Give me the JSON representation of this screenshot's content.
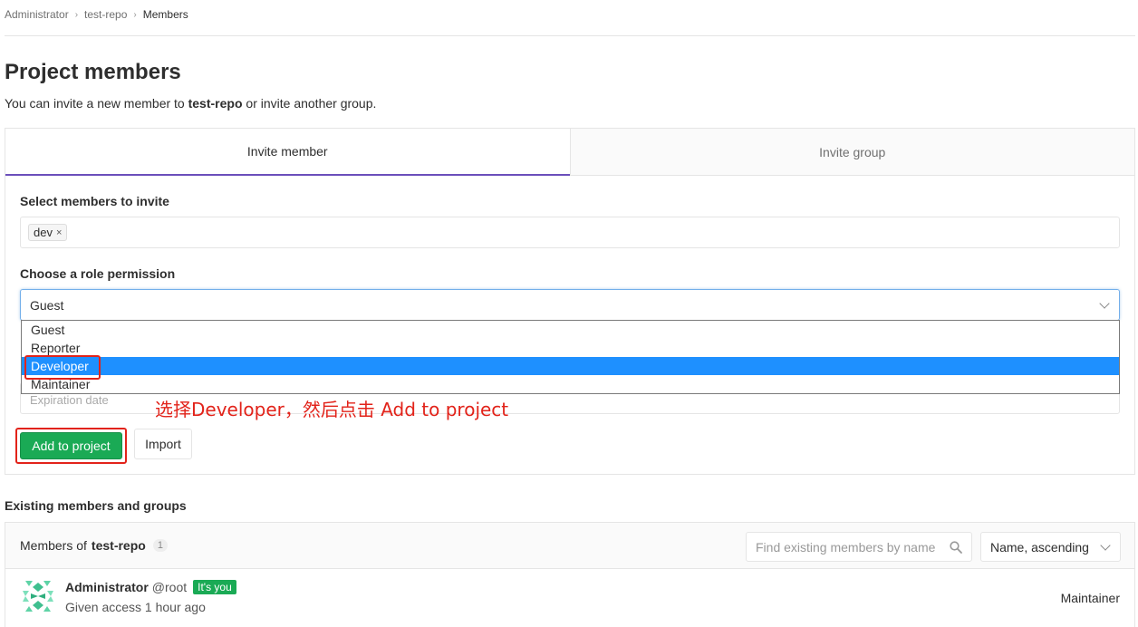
{
  "breadcrumb": {
    "items": [
      "Administrator",
      "test-repo",
      "Members"
    ],
    "separator": "›"
  },
  "page": {
    "title": "Project members",
    "intro_prefix": "You can invite a new member to ",
    "intro_project": "test-repo",
    "intro_suffix": " or invite another group."
  },
  "tabs": [
    {
      "label": "Invite member",
      "active": true
    },
    {
      "label": "Invite group",
      "active": false
    }
  ],
  "invite_form": {
    "select_members_label": "Select members to invite",
    "selected_members": [
      "dev"
    ],
    "token_remove_glyph": "×",
    "role_label": "Choose a role permission",
    "role_value": "Guest",
    "role_options": [
      "Guest",
      "Reporter",
      "Developer",
      "Maintainer"
    ],
    "highlighted_option": "Developer",
    "expiration_placeholder": "Expiration date",
    "add_button": "Add to project",
    "import_button": "Import"
  },
  "annotation": {
    "text": "选择Developer，然后点击 Add to project",
    "color": "#e2231a"
  },
  "existing": {
    "heading": "Existing members and groups",
    "header_prefix": "Members of ",
    "header_project": "test-repo",
    "count": "1",
    "search_placeholder": "Find existing members by name",
    "sort_value": "Name, ascending",
    "members": [
      {
        "name": "Administrator",
        "username": "@root",
        "badge": "It's you",
        "access": "Given access 1 hour ago",
        "role": "Maintainer"
      }
    ]
  },
  "colors": {
    "active_tab_border": "#6b4fbb",
    "primary_button": "#1aaa55",
    "selected_option": "#1e90ff",
    "highlight_box": "#e2231a"
  },
  "icons": [
    "chevron-right-icon",
    "close-icon",
    "chevron-down-icon",
    "search-icon",
    "identicon-avatar"
  ]
}
